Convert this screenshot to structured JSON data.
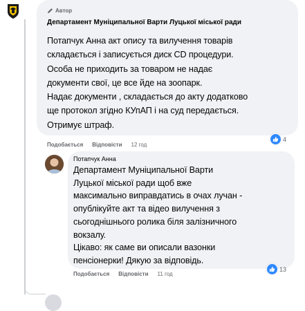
{
  "comment": {
    "badge": "Автор",
    "author": "Департамент Муніципальної Варти Луцької міської ради",
    "text": "Потапчук Анна акт опису та вилучення товарів\nскладається і записується диск CD процедури.\nОсоба не приходить за товаром не надає\nдокументи свої, це все йде на зоопарк.\nНадає документи , складається до акту додатково\nще протокол згідно КУпАП і на суд передається.\nОтримує штраф.",
    "actions": {
      "like": "Подобається",
      "reply": "Відповісти",
      "time": "12 год"
    },
    "reactions_count": "4"
  },
  "reply": {
    "author": "Потапчук Анна",
    "text": "Департамент Муніципальної Варти\nЛуцької міської ради щоб вже\nмаксимально виправдатись в очах лучан -\nопублікуйте акт та відео вилучення з\nсьогоднішнього ролика біля залізничного\nвокзалу.\nЦікаво: як саме ви описали вазонки\nпенсіонерки! Дякую за відповідь.",
    "actions": {
      "like": "Подобається",
      "reply": "Відповісти",
      "time": "11 год"
    },
    "reactions_count": "13"
  },
  "colors": {
    "bubble": "#f0f2f5",
    "secondary_text": "#65676b",
    "like_blue": "#2d88ff"
  }
}
